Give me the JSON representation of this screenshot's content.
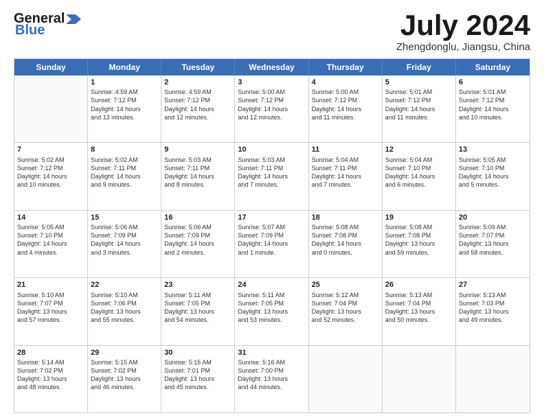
{
  "header": {
    "logo_general": "General",
    "logo_blue": "Blue",
    "month": "July 2024",
    "location": "Zhengdonglu, Jiangsu, China"
  },
  "weekdays": [
    "Sunday",
    "Monday",
    "Tuesday",
    "Wednesday",
    "Thursday",
    "Friday",
    "Saturday"
  ],
  "weeks": [
    [
      {
        "day": "",
        "info": ""
      },
      {
        "day": "1",
        "info": "Sunrise: 4:59 AM\nSunset: 7:12 PM\nDaylight: 14 hours\nand 13 minutes."
      },
      {
        "day": "2",
        "info": "Sunrise: 4:59 AM\nSunset: 7:12 PM\nDaylight: 14 hours\nand 12 minutes."
      },
      {
        "day": "3",
        "info": "Sunrise: 5:00 AM\nSunset: 7:12 PM\nDaylight: 14 hours\nand 12 minutes."
      },
      {
        "day": "4",
        "info": "Sunrise: 5:00 AM\nSunset: 7:12 PM\nDaylight: 14 hours\nand 11 minutes."
      },
      {
        "day": "5",
        "info": "Sunrise: 5:01 AM\nSunset: 7:12 PM\nDaylight: 14 hours\nand 11 minutes."
      },
      {
        "day": "6",
        "info": "Sunrise: 5:01 AM\nSunset: 7:12 PM\nDaylight: 14 hours\nand 10 minutes."
      }
    ],
    [
      {
        "day": "7",
        "info": "Sunrise: 5:02 AM\nSunset: 7:12 PM\nDaylight: 14 hours\nand 10 minutes."
      },
      {
        "day": "8",
        "info": "Sunrise: 5:02 AM\nSunset: 7:11 PM\nDaylight: 14 hours\nand 9 minutes."
      },
      {
        "day": "9",
        "info": "Sunrise: 5:03 AM\nSunset: 7:11 PM\nDaylight: 14 hours\nand 8 minutes."
      },
      {
        "day": "10",
        "info": "Sunrise: 5:03 AM\nSunset: 7:11 PM\nDaylight: 14 hours\nand 7 minutes."
      },
      {
        "day": "11",
        "info": "Sunrise: 5:04 AM\nSunset: 7:11 PM\nDaylight: 14 hours\nand 7 minutes."
      },
      {
        "day": "12",
        "info": "Sunrise: 5:04 AM\nSunset: 7:10 PM\nDaylight: 14 hours\nand 6 minutes."
      },
      {
        "day": "13",
        "info": "Sunrise: 5:05 AM\nSunset: 7:10 PM\nDaylight: 14 hours\nand 5 minutes."
      }
    ],
    [
      {
        "day": "14",
        "info": "Sunrise: 5:05 AM\nSunset: 7:10 PM\nDaylight: 14 hours\nand 4 minutes."
      },
      {
        "day": "15",
        "info": "Sunrise: 5:06 AM\nSunset: 7:09 PM\nDaylight: 14 hours\nand 3 minutes."
      },
      {
        "day": "16",
        "info": "Sunrise: 5:06 AM\nSunset: 7:09 PM\nDaylight: 14 hours\nand 2 minutes."
      },
      {
        "day": "17",
        "info": "Sunrise: 5:07 AM\nSunset: 7:09 PM\nDaylight: 14 hours\nand 1 minute."
      },
      {
        "day": "18",
        "info": "Sunrise: 5:08 AM\nSunset: 7:08 PM\nDaylight: 14 hours\nand 0 minutes."
      },
      {
        "day": "19",
        "info": "Sunrise: 5:08 AM\nSunset: 7:08 PM\nDaylight: 13 hours\nand 59 minutes."
      },
      {
        "day": "20",
        "info": "Sunrise: 5:09 AM\nSunset: 7:07 PM\nDaylight: 13 hours\nand 58 minutes."
      }
    ],
    [
      {
        "day": "21",
        "info": "Sunrise: 5:10 AM\nSunset: 7:07 PM\nDaylight: 13 hours\nand 57 minutes."
      },
      {
        "day": "22",
        "info": "Sunrise: 5:10 AM\nSunset: 7:06 PM\nDaylight: 13 hours\nand 55 minutes."
      },
      {
        "day": "23",
        "info": "Sunrise: 5:11 AM\nSunset: 7:05 PM\nDaylight: 13 hours\nand 54 minutes."
      },
      {
        "day": "24",
        "info": "Sunrise: 5:11 AM\nSunset: 7:05 PM\nDaylight: 13 hours\nand 53 minutes."
      },
      {
        "day": "25",
        "info": "Sunrise: 5:12 AM\nSunset: 7:04 PM\nDaylight: 13 hours\nand 52 minutes."
      },
      {
        "day": "26",
        "info": "Sunrise: 5:13 AM\nSunset: 7:04 PM\nDaylight: 13 hours\nand 50 minutes."
      },
      {
        "day": "27",
        "info": "Sunrise: 5:13 AM\nSunset: 7:03 PM\nDaylight: 13 hours\nand 49 minutes."
      }
    ],
    [
      {
        "day": "28",
        "info": "Sunrise: 5:14 AM\nSunset: 7:02 PM\nDaylight: 13 hours\nand 48 minutes."
      },
      {
        "day": "29",
        "info": "Sunrise: 5:15 AM\nSunset: 7:02 PM\nDaylight: 13 hours\nand 46 minutes."
      },
      {
        "day": "30",
        "info": "Sunrise: 5:15 AM\nSunset: 7:01 PM\nDaylight: 13 hours\nand 45 minutes."
      },
      {
        "day": "31",
        "info": "Sunrise: 5:16 AM\nSunset: 7:00 PM\nDaylight: 13 hours\nand 44 minutes."
      },
      {
        "day": "",
        "info": ""
      },
      {
        "day": "",
        "info": ""
      },
      {
        "day": "",
        "info": ""
      }
    ]
  ]
}
